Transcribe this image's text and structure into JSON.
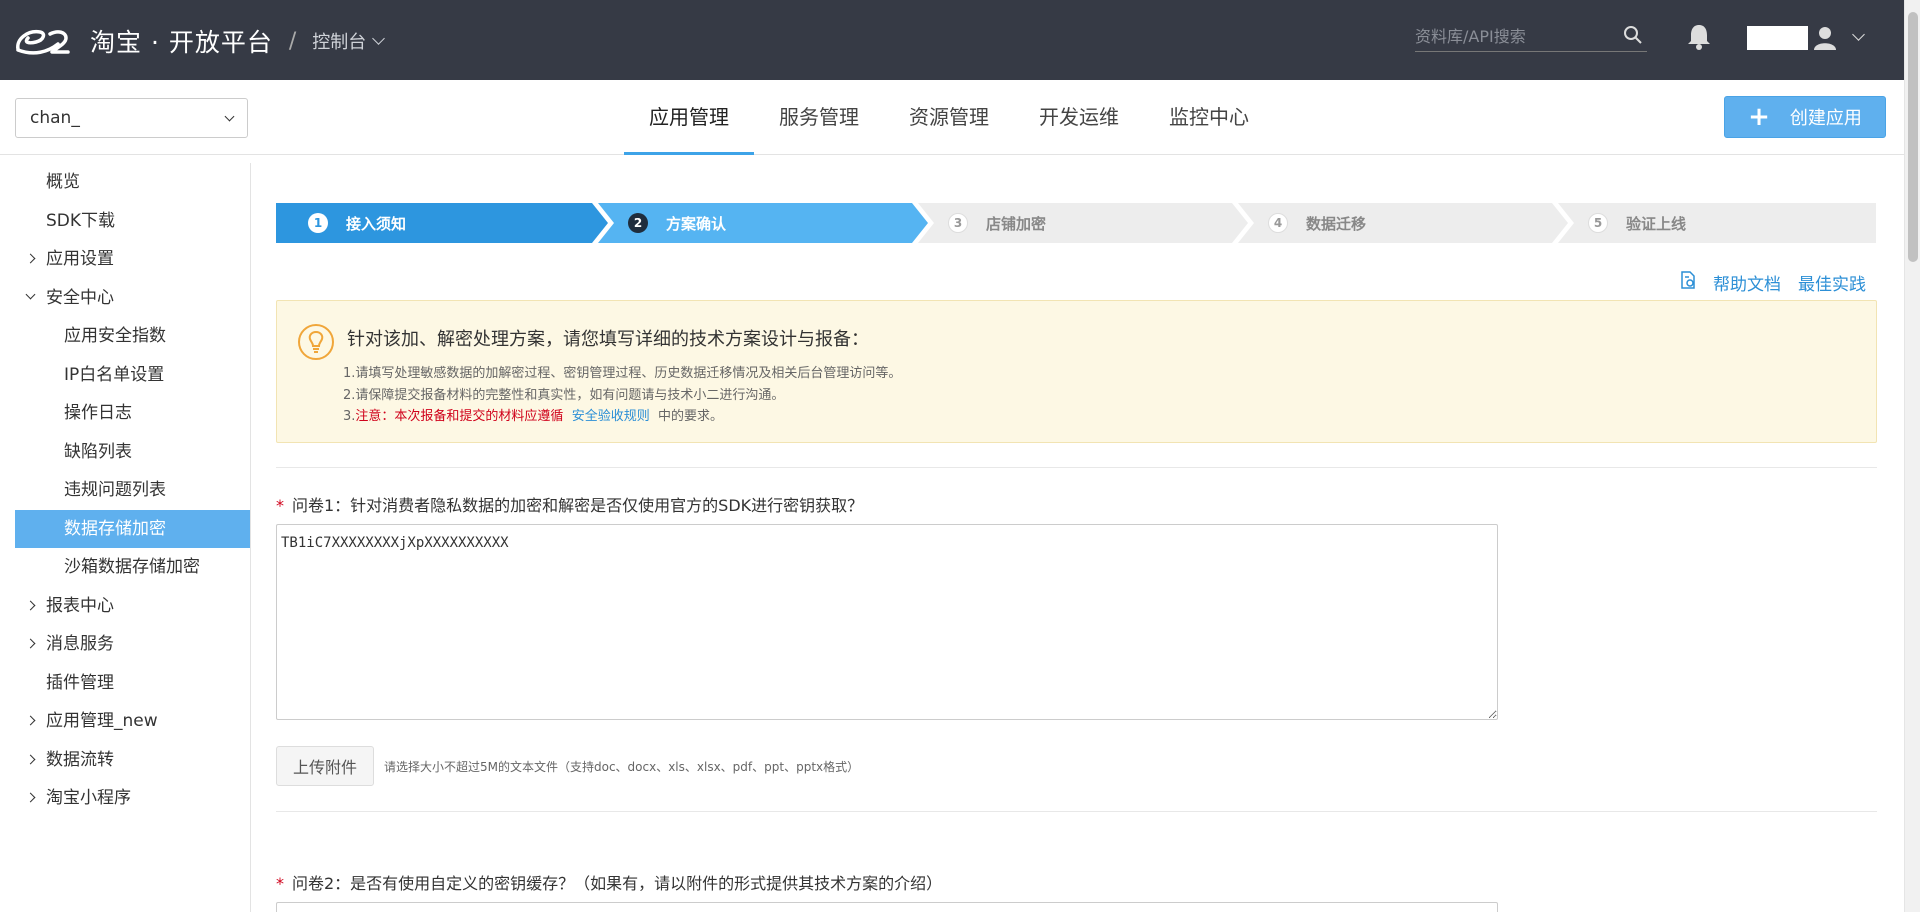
{
  "header": {
    "brand": "淘宝 · 开放平台",
    "separator": "/",
    "console_label": "控制台",
    "search_placeholder": "资料库/API搜索"
  },
  "subheader": {
    "app_select_value": "chan_",
    "nav": [
      "应用管理",
      "服务管理",
      "资源管理",
      "开发运维",
      "监控中心"
    ],
    "active_nav": "应用管理",
    "create_button": "创建应用"
  },
  "sidebar": {
    "items": [
      {
        "label": "概览",
        "level": 1,
        "arrow": "none"
      },
      {
        "label": "SDK下载",
        "level": 1,
        "arrow": "none"
      },
      {
        "label": "应用设置",
        "level": 1,
        "arrow": "right"
      },
      {
        "label": "安全中心",
        "level": 1,
        "arrow": "down"
      },
      {
        "label": "应用安全指数",
        "level": 2
      },
      {
        "label": "IP白名单设置",
        "level": 2
      },
      {
        "label": "操作日志",
        "level": 2
      },
      {
        "label": "缺陷列表",
        "level": 2
      },
      {
        "label": "违规问题列表",
        "level": 2
      },
      {
        "label": "数据存储加密",
        "level": 2,
        "active": true
      },
      {
        "label": "沙箱数据存储加密",
        "level": 2
      },
      {
        "label": "报表中心",
        "level": 1,
        "arrow": "right"
      },
      {
        "label": "消息服务",
        "level": 1,
        "arrow": "right"
      },
      {
        "label": "插件管理",
        "level": 1,
        "arrow": "none"
      },
      {
        "label": "应用管理_new",
        "level": 1,
        "arrow": "right"
      },
      {
        "label": "数据流转",
        "level": 1,
        "arrow": "right"
      },
      {
        "label": "淘宝小程序",
        "level": 1,
        "arrow": "right"
      }
    ]
  },
  "steps": [
    {
      "num": "1",
      "label": "接入须知",
      "state": "done"
    },
    {
      "num": "2",
      "label": "方案确认",
      "state": "current"
    },
    {
      "num": "3",
      "label": "店铺加密",
      "state": "todo"
    },
    {
      "num": "4",
      "label": "数据迁移",
      "state": "todo"
    },
    {
      "num": "5",
      "label": "验证上线",
      "state": "todo"
    }
  ],
  "links": {
    "help_doc": "帮助文档",
    "best_practice": "最佳实践"
  },
  "notice": {
    "title": "针对该加、解密处理方案，请您填写详细的技术方案设计与报备：",
    "line1": "1.请填写处理敏感数据的加解密过程、密钥管理过程、历史数据迁移情况及相关后台管理访问等。",
    "line2": "2.请保障提交报备材料的完整性和真实性，如有问题请与技术小二进行沟通。",
    "line3_prefix": "3.",
    "line3_red": "注意：本次报备和提交的材料应遵循",
    "line3_link": "安全验收规则",
    "line3_suffix": "中的要求。"
  },
  "q1": {
    "star": "*",
    "label": "问卷1：针对消费者隐私数据的加密和解密是否仅使用官方的SDK进行密钥获取？",
    "answer": "TB1iC7XXXXXXXXjXpXXXXXXXXXX",
    "upload_button": "上传附件",
    "upload_hint": "请选择大小不超过5M的文本文件（支持doc、docx、xls、xlsx、pdf、ppt、pptx格式）"
  },
  "q2": {
    "star": "*",
    "label": "问卷2：是否有使用自定义的密钥缓存？（如果有，请以附件的形式提供其技术方案的介绍）"
  },
  "colors": {
    "topbar": "#363a45",
    "accent": "#3da3e8",
    "step_done": "#2d96df",
    "step_current": "#55b4f2",
    "step_todo": "#ededed",
    "notice_bg": "#fdf8e4",
    "required": "#d0021b"
  }
}
